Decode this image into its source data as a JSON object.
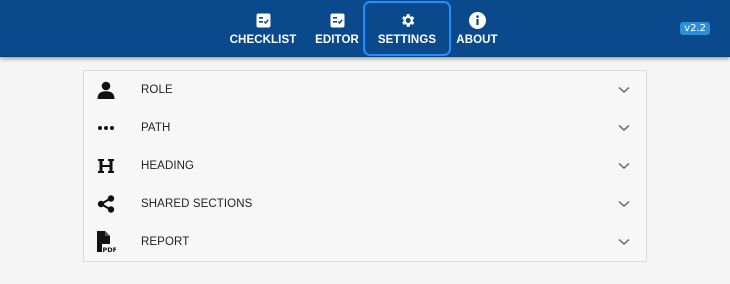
{
  "nav": {
    "items": [
      {
        "label": "CHECKLIST",
        "icon": "checklist-icon"
      },
      {
        "label": "EDITOR",
        "icon": "editor-icon"
      },
      {
        "label": "SETTINGS",
        "icon": "gear-icon",
        "active": true
      },
      {
        "label": "ABOUT",
        "icon": "info-icon"
      }
    ],
    "version": "v2.2"
  },
  "settings": {
    "sections": [
      {
        "label": "ROLE",
        "icon": "person-icon"
      },
      {
        "label": "PATH",
        "icon": "ellipsis-icon"
      },
      {
        "label": "HEADING",
        "icon": "heading-icon"
      },
      {
        "label": "SHARED SECTIONS",
        "icon": "share-icon"
      },
      {
        "label": "REPORT",
        "icon": "pdf-icon"
      }
    ]
  },
  "colors": {
    "header_bg": "#0a4a8c",
    "active_outline": "#1e90ff",
    "badge_bg": "#2d8fd8",
    "page_bg": "#f5f5f5"
  }
}
